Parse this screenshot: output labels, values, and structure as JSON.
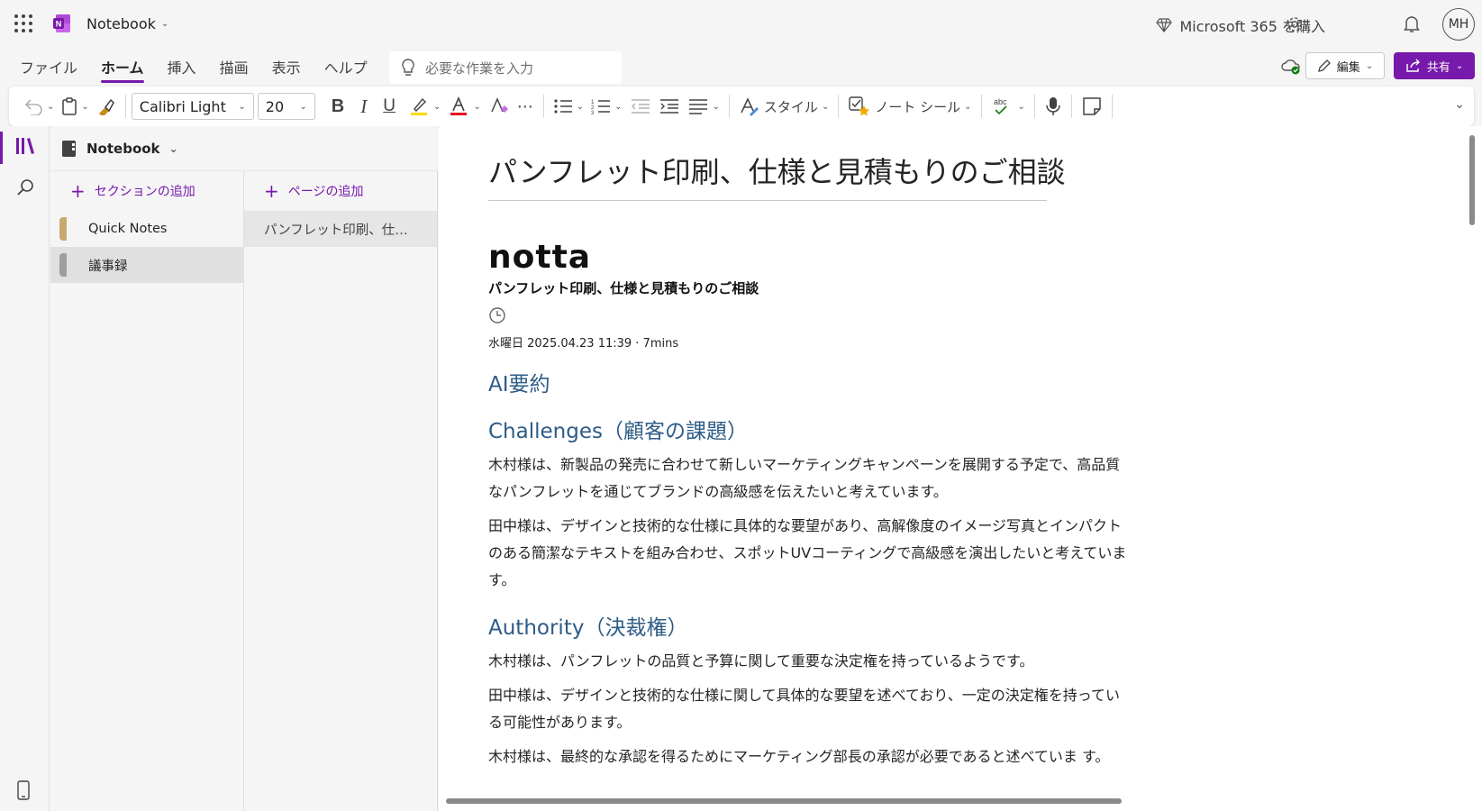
{
  "app": {
    "title": "Notebook",
    "buy365": "Microsoft 365 を購入",
    "avatar": "MH"
  },
  "menu": {
    "tabs": [
      "ファイル",
      "ホーム",
      "挿入",
      "描画",
      "表示",
      "ヘルプ"
    ],
    "active_tab": "ホーム",
    "tell_me_placeholder": "必要な作業を入力",
    "edit_label": "編集",
    "share_label": "共有"
  },
  "ribbon": {
    "font": "Calibri Light",
    "size": "20",
    "style_label": "スタイル",
    "tags_label": "ノート シール",
    "spell_label": "abc"
  },
  "colors": {
    "accent": "#7719aa",
    "heading": "#2e5c86",
    "font_color": "#e81123"
  },
  "sidebar": {
    "notebook": "Notebook",
    "add_section": "セクションの追加",
    "add_page": "ページの追加",
    "sections": [
      {
        "label": "Quick Notes",
        "color": "#c9a96e"
      },
      {
        "label": "議事録",
        "color": "#9e9e9e"
      }
    ],
    "pages": [
      "パンフレット印刷、仕…"
    ]
  },
  "page": {
    "title": "パンフレット印刷、仕様と見積もりのご相談",
    "brand": "notta",
    "subtitle": "パンフレット印刷、仕様と見積もりのご相談",
    "meta": "水曜日 2025.04.23 11:39 · 7mins",
    "h_summary": "AI要約",
    "h_challenges": "Challenges（顧客の課題）",
    "challenges_p1": "木村様は、新製品の発売に合わせて新しいマーケティングキャンペーンを展開する予定で、高品質なパンフレットを通じてブランドの高級感を伝えたいと考えています。",
    "challenges_p2": "田中様は、デザインと技術的な仕様に具体的な要望があり、高解像度のイメージ写真とインパクトのある簡潔なテキストを組み合わせ、スポットUVコーティングで高級感を演出したいと考えています。",
    "h_authority": "Authority（決裁権）",
    "authority_p1": "木村様は、パンフレットの品質と予算に関して重要な決定権を持っているようです。",
    "authority_p2": "田中様は、デザインと技術的な仕様に関して具体的な要望を述べており、一定の決定権を持っている可能性があります。",
    "authority_p3": "木村様は、最終的な承認を得るためにマーケティング部長の承認が必要であると述べていま す。"
  }
}
